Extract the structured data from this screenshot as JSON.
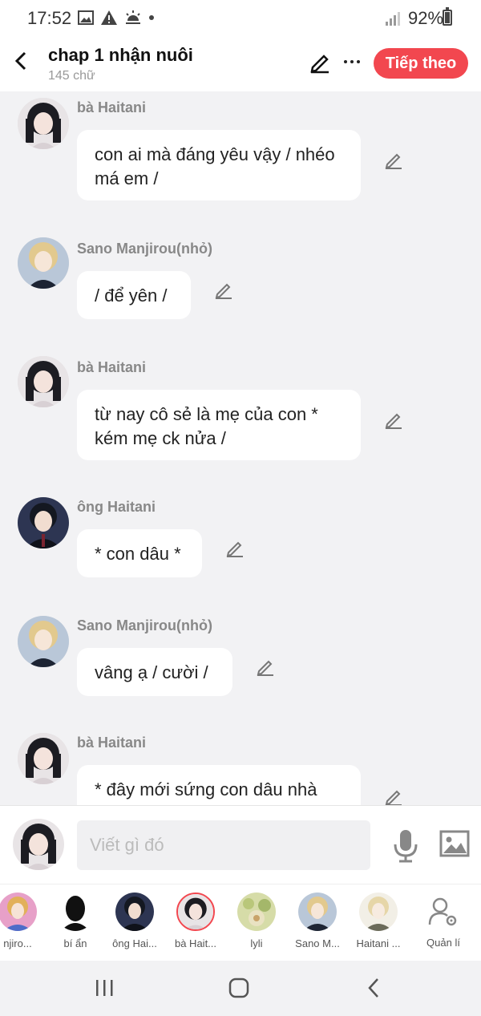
{
  "status_bar": {
    "time": "17:52",
    "battery": "92%"
  },
  "header": {
    "title": "chap 1 nhận nuôi",
    "word_count": "145 chữ",
    "next_label": "Tiếp theo",
    "accent": "#f2474f"
  },
  "messages": [
    {
      "speaker": "bà Haitani",
      "text": "con ai mà đáng yêu vậy / nhéo má em /",
      "avatar": "dark-hair-woman"
    },
    {
      "speaker": "Sano Manjirou(nhỏ)",
      "text": "/ để yên /",
      "avatar": "blond-boy"
    },
    {
      "speaker": "bà Haitani",
      "text": "từ nay cô sẻ là mẹ của con * kém mẹ ck nửa /",
      "avatar": "dark-hair-woman"
    },
    {
      "speaker": "ông Haitani",
      "text": "* con dâu *",
      "avatar": "dark-hair-man"
    },
    {
      "speaker": "Sano Manjirou(nhỏ)",
      "text": "vâng ạ / cười /",
      "avatar": "blond-boy"
    },
    {
      "speaker": "bà Haitani",
      "text": "* đây mới sứng con dâu nhà",
      "avatar": "dark-hair-woman"
    }
  ],
  "composer": {
    "placeholder": "Viết gì đó"
  },
  "characters": [
    {
      "name": "njiro..."
    },
    {
      "name": "bí ẩn"
    },
    {
      "name": "ông Hai..."
    },
    {
      "name": "bà Hait..."
    },
    {
      "name": "lyli"
    },
    {
      "name": "Sano M..."
    },
    {
      "name": "Haitani ..."
    }
  ],
  "manage_label": "Quản lí"
}
